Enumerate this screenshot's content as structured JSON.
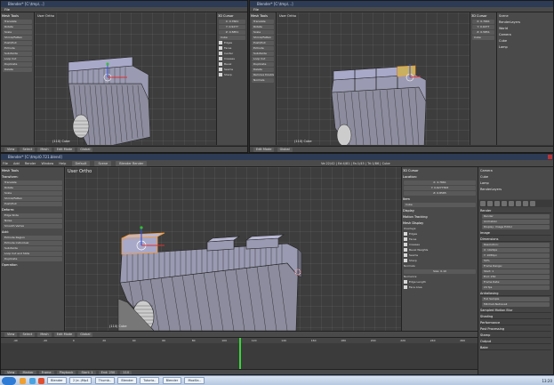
{
  "colors": {
    "mesh_face": "#a8a8c8",
    "mesh_edge": "#222222",
    "mesh_side": "#8c8c9e",
    "select_orange": "#ff9a2e",
    "gizmo_red": "#e03030",
    "gizmo_green": "#30c030",
    "gizmo_blue": "#3050e0",
    "timeline_cursor": "#3bd43b",
    "taskbar": "#c8d6ea"
  },
  "top_left": {
    "titlebar": "Blender* [C:\\tmp\\...]",
    "viewport_label": "User Ortho",
    "obj_label": "(110) Cube",
    "tool_header": "Mesh Tools",
    "tool_items": [
      "Translate",
      "Rotate",
      "Scale",
      "Shrink/Fatten",
      "Push/Pull",
      "Extrude",
      "Subdivide",
      "Loop Cut",
      "Duplicate",
      "Delete"
    ],
    "bottom_items": [
      "View",
      "Select",
      "Mesh",
      "Edit Mode",
      "Global"
    ],
    "props_header": "3D Cursor",
    "props_values": [
      "X: 0.7661",
      "Y: 0.9277",
      "Z: 0.5851",
      "Cube"
    ],
    "display_checks": [
      "Edges",
      "Faces",
      "Center",
      "Creases",
      "Bevel",
      "Seams",
      "Sharp"
    ]
  },
  "top_right": {
    "titlebar": "Blender* [C:\\tmp\\...]",
    "viewport_label": "User Ortho",
    "obj_label": "(110) Cube",
    "tool_header": "Mesh Tools",
    "tool_items": [
      "Translate",
      "Rotate",
      "Scale",
      "Shrink/Fatten",
      "Push/Pull",
      "Extrude",
      "Subdivide",
      "Loop Cut",
      "Duplicate",
      "Delete",
      "Remove Doubles",
      "Normals"
    ],
    "bottom_items": [
      "Edit Mode",
      "Global"
    ],
    "props_header": "3D Cursor",
    "props_values": [
      "X: 0.7661",
      "Y: 0.9277",
      "Z: 0.5851",
      "Cube"
    ],
    "outliner_items": [
      "Scene",
      "RenderLayers",
      "World",
      "Camera",
      "Cube",
      "Lamp"
    ]
  },
  "main": {
    "infobar": {
      "items": [
        "File",
        "Add",
        "Render",
        "Window",
        "Help"
      ],
      "layout": "Default",
      "scene": "Scene",
      "engine": "Blender Render",
      "stats": "Ve:22/42 | Ed:4/81 | Fa:1/45 | Tri:1/86 | Cube"
    },
    "viewport_label": "User Ortho",
    "obj_label": "(110) Cube",
    "tool": {
      "header1": "Mesh Tools",
      "deform_header": "Transform:",
      "deform_items": [
        "Translate",
        "Rotate",
        "Scale",
        "Shrink/Fatten",
        "Push/Pull"
      ],
      "add_header": "Deform:",
      "add_items": [
        "Edge Slide",
        "Noise",
        "Smooth Vertex"
      ],
      "add2_header": "Add:",
      "add2_items": [
        "Extrude Region",
        "Extrude Individual",
        "Subdivide",
        "Loop Cut and Slide",
        "Duplicate"
      ],
      "operation": "Operation"
    },
    "props": {
      "header": "3D Cursor",
      "location_label": "Location:",
      "loc": [
        "X: 4.7661",
        "Y: 0.6277563",
        "Z: 0.8585"
      ],
      "item_header": "Item",
      "item_name": "Cube",
      "display_header": "Display",
      "motion_header": "Motion Tracking",
      "mesh_display_header": "Mesh Display",
      "overlays_label": "Overlays:",
      "checks": [
        "Edges",
        "Faces",
        "Creases",
        "Bevel Weights",
        "Seams",
        "Sharp"
      ],
      "normals_label": "Normals:",
      "size_value": "Size: 0.10",
      "numerics_label": "Numerics:",
      "numerics": [
        "Edge Length",
        "Face Area"
      ]
    },
    "outliner": [
      "Camera",
      "Cube",
      "Lamp",
      "RenderLayers"
    ],
    "propeditor": {
      "sections": [
        "Render",
        "Image",
        "Dimensions",
        "Antialiasing",
        "Sampled Motion Blur",
        "Shading",
        "Performance",
        "Post Processing",
        "Stamp",
        "Output",
        "Bake"
      ],
      "fields": [
        "Render",
        "Animation",
        "Display: Image Editor",
        "Resolution:",
        "X: 1920px",
        "Y: 1080px",
        "50%",
        "Frame Range:",
        "Start: 1",
        "End: 250",
        "Frame Rate:",
        "24 fps",
        "Full Sample",
        "Mitchell-Netravali"
      ]
    },
    "viewport_menu": [
      "View",
      "Select",
      "Mesh",
      "Edit Mode",
      "Global"
    ],
    "timeline": {
      "ticks": [
        "-40",
        "-20",
        "0",
        "20",
        "40",
        "60",
        "80",
        "100",
        "120",
        "140",
        "160",
        "180",
        "200",
        "220",
        "240",
        "260"
      ],
      "menu": [
        "View",
        "Marker",
        "Frame",
        "Playback"
      ],
      "start": "Start: 1",
      "end": "End: 250",
      "current": "110",
      "cursor_frame": 110,
      "range_min": -50,
      "range_max": 270
    }
  },
  "taskbar": {
    "tasks": [
      "Blender",
      "2 Je..\\Mp4",
      "Thumb..",
      "Blender",
      "Tutoria..",
      "Blender",
      "Mozilla.."
    ],
    "clock": "13:20"
  }
}
